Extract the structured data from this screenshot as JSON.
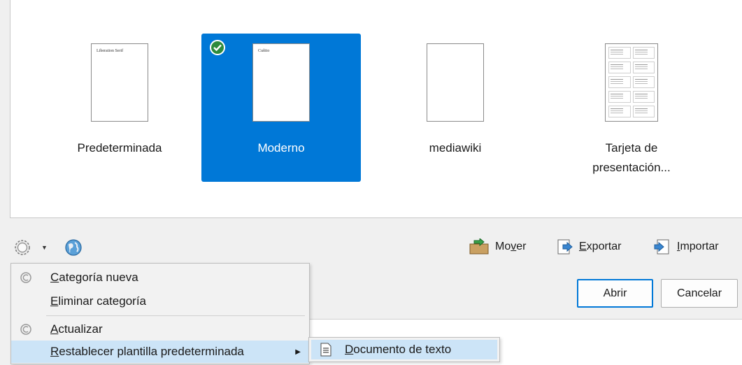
{
  "templates": [
    {
      "label": "Predeterminada",
      "thumb_text": "Liberation Serif",
      "selected": false
    },
    {
      "label": "Moderno",
      "thumb_text": "Cuñito",
      "selected": true
    },
    {
      "label": "mediawiki",
      "thumb_text": "",
      "selected": false
    },
    {
      "label": "Tarjeta de presentación...",
      "label_line1": "Tarjeta de",
      "label_line2": "presentación...",
      "thumb_text": "",
      "selected": false
    }
  ],
  "toolbar": {
    "move_label_pre": "Mo",
    "move_label_u": "v",
    "move_label_post": "er",
    "export_label_u": "E",
    "export_label_post": "xportar",
    "import_label_u": "I",
    "import_label_post": "mportar"
  },
  "buttons": {
    "open": "Abrir",
    "cancel": "Cancelar"
  },
  "menu": {
    "new_category_u": "C",
    "new_category_post": "ategoría nueva",
    "delete_category_u": "E",
    "delete_category_post": "liminar categoría",
    "refresh_u": "A",
    "refresh_post": "ctualizar",
    "reset_default_u": "R",
    "reset_default_post": "establecer plantilla predeterminada"
  },
  "submenu": {
    "text_document_u": "D",
    "text_document_post": "ocumento de texto"
  },
  "colors": {
    "selection": "#0078d7",
    "menu_highlight": "#cce4f7",
    "check": "#2e8b3d"
  }
}
